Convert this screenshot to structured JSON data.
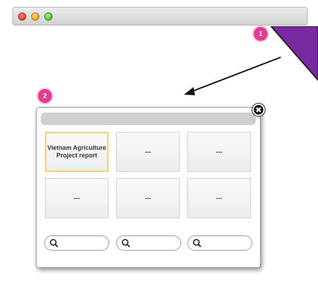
{
  "window": {
    "title_lights": [
      "close",
      "minimize",
      "zoom"
    ]
  },
  "annotations": {
    "badge_1": "1",
    "badge_2": "2"
  },
  "dialog": {
    "close_glyph": "✖",
    "tiles": [
      "Vietnam Agriculture Project report",
      "---",
      "---",
      "---",
      "---",
      "---"
    ],
    "selected_tile": 0,
    "search_fields": [
      {
        "value": "",
        "icon": "search-icon"
      },
      {
        "value": "",
        "icon": "search-icon"
      },
      {
        "value": "",
        "icon": "search-icon"
      }
    ]
  },
  "colors": {
    "badge": "#e23c93",
    "corner_fold": "#7a2aa0",
    "selected_border": "#f2cf7e"
  }
}
